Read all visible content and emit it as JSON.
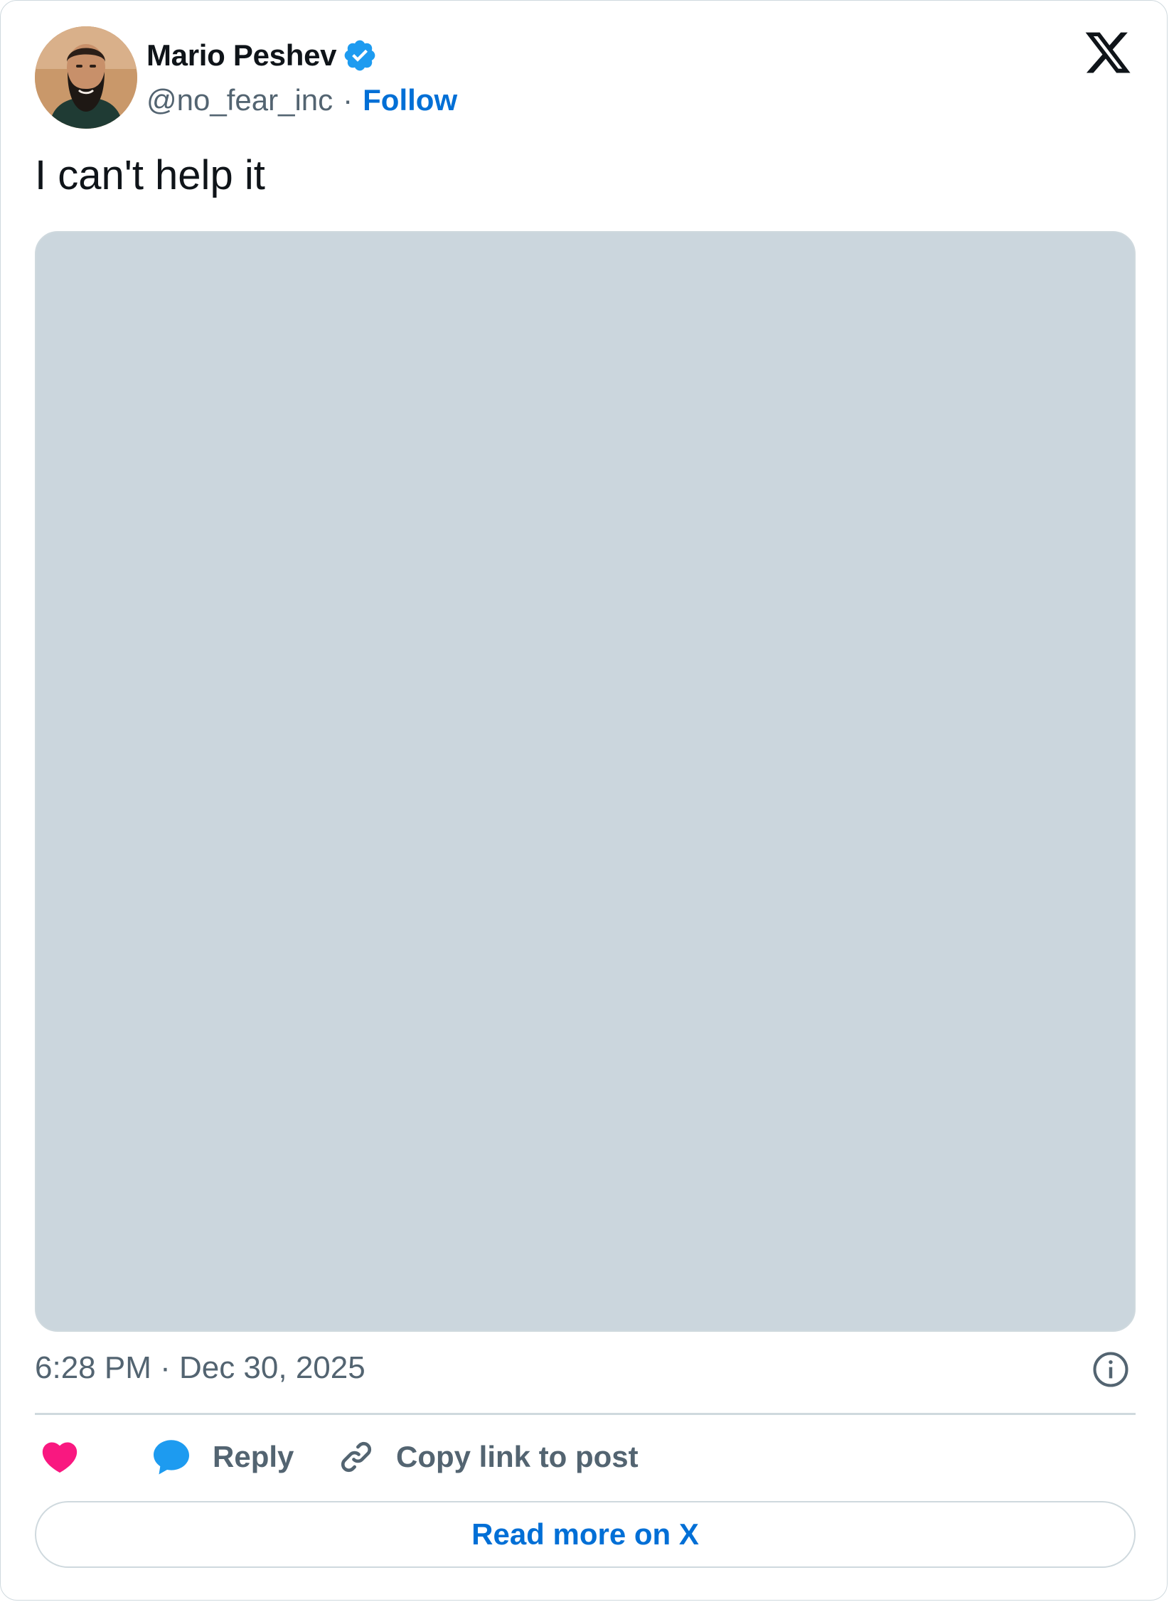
{
  "author": {
    "name": "Mario Peshev",
    "handle": "@no_fear_inc",
    "separator": "·",
    "follow_label": "Follow",
    "verified": true
  },
  "post": {
    "text": "I can't help it",
    "timestamp": "6:28 PM · Dec 30, 2025"
  },
  "actions": {
    "like_icon": "heart-icon",
    "reply_label": "Reply",
    "copy_link_label": "Copy link to post"
  },
  "read_more_label": "Read more on X",
  "icons": [
    "x-logo-icon",
    "verified-badge-icon",
    "info-icon",
    "heart-icon",
    "reply-bubble-icon",
    "link-icon"
  ],
  "colors": {
    "link": "#006fd6",
    "text_primary": "#0f1419",
    "text_secondary": "#536471",
    "verified": "#1d9bf0",
    "heart": "#f91880",
    "media_placeholder": "#cbd6dd",
    "border": "#cfd9de"
  }
}
